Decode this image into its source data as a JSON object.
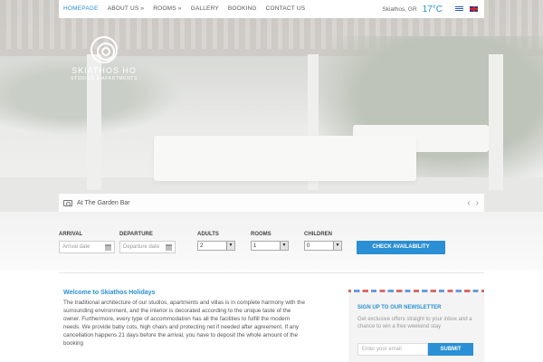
{
  "nav": {
    "items": [
      {
        "label": "HOMEPAGE",
        "active": true
      },
      {
        "label": "ABOUT US »",
        "active": false
      },
      {
        "label": "ROOMS »",
        "active": false
      },
      {
        "label": "GALLERY",
        "active": false
      },
      {
        "label": "BOOKING",
        "active": false
      },
      {
        "label": "CONTACT US",
        "active": false
      }
    ],
    "weather": {
      "location": "Skiathos, GR",
      "temperature": "17°C"
    },
    "languages": [
      "Greek",
      "English"
    ]
  },
  "logo": {
    "name": "SKIATHOS HO",
    "tagline": "STUDIOS & APARTMENTS"
  },
  "hero": {
    "caption": "At The Garden Bar",
    "prev_arrow": "‹",
    "next_arrow": "›"
  },
  "booking": {
    "arrival": {
      "label": "ARRIVAL",
      "placeholder": "Arrival date"
    },
    "departure": {
      "label": "DEPARTURE",
      "placeholder": "Departure date"
    },
    "adults": {
      "label": "ADULTS",
      "value": "2"
    },
    "rooms": {
      "label": "ROOMS",
      "value": "1"
    },
    "children": {
      "label": "CHILDREN",
      "value": "0"
    },
    "button": "CHECK AVAILABILITY"
  },
  "welcome": {
    "title": "Welcome to Skiathos Holidays",
    "body": "The traditional architecture of our studios, apartments and villas is in complete harmony with the surrounding environment, and the interior is decorated according to the unique taste of the owner. Furthermore, every type of accommodation has all the facilities to fulfill the modern needs. We provide baby cots, high chairs and protecting net if needed after agreement. If any cancellation happens 21 days before the arrival, you have to deposit the whole amount of the booking"
  },
  "newsletter": {
    "title": "SIGN UP TO OUR NEWSLETTER",
    "text": "Get exclusive offers straight to your inbox and a chance to win a free weekend stay",
    "placeholder": "Enter your email",
    "button": "SUBMIT"
  },
  "colors": {
    "accent": "#2a8fd4"
  }
}
